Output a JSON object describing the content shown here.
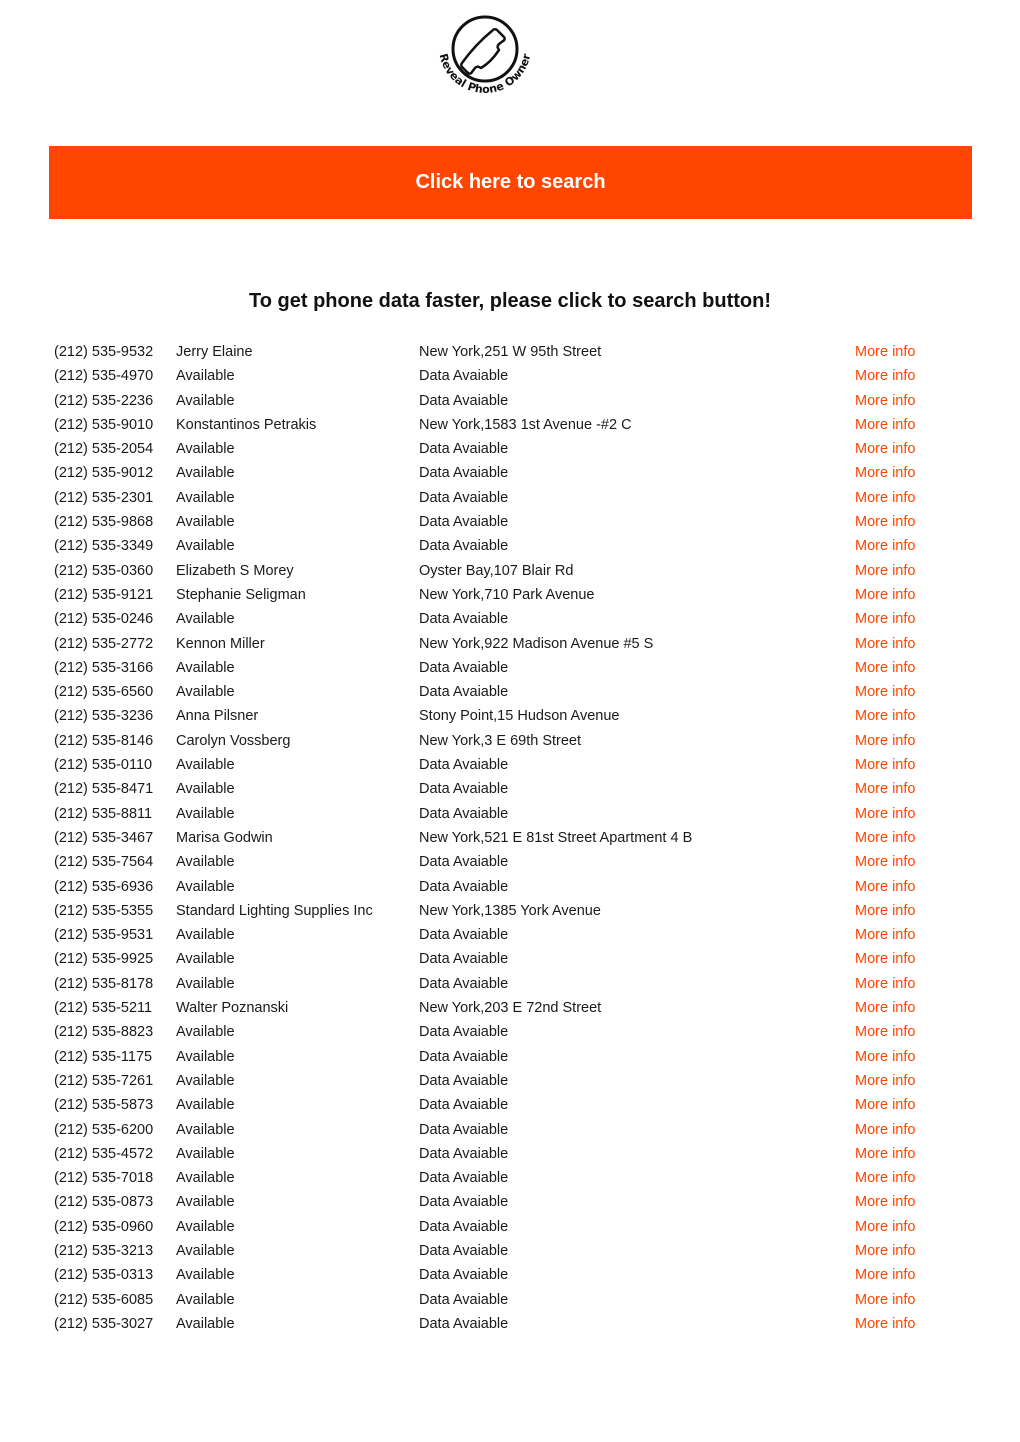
{
  "logo": {
    "text": "Reveal Phone Owner",
    "icon": "phone-handset-icon"
  },
  "banner": {
    "label": "Click here to search",
    "color": "#ff4500"
  },
  "headline": "To get phone data faster, please click to search button!",
  "more_label": "More info",
  "rows": [
    {
      "phone": "(212) 535-9532",
      "name": "Jerry Elaine",
      "address": "New York,251 W 95th Street"
    },
    {
      "phone": "(212) 535-4970",
      "name": "Available",
      "address": "Data Avaiable"
    },
    {
      "phone": "(212) 535-2236",
      "name": "Available",
      "address": "Data Avaiable"
    },
    {
      "phone": "(212) 535-9010",
      "name": "Konstantinos Petrakis",
      "address": "New York,1583 1st Avenue -#2 C"
    },
    {
      "phone": "(212) 535-2054",
      "name": "Available",
      "address": "Data Avaiable"
    },
    {
      "phone": "(212) 535-9012",
      "name": "Available",
      "address": "Data Avaiable"
    },
    {
      "phone": "(212) 535-2301",
      "name": "Available",
      "address": "Data Avaiable"
    },
    {
      "phone": "(212) 535-9868",
      "name": "Available",
      "address": "Data Avaiable"
    },
    {
      "phone": "(212) 535-3349",
      "name": "Available",
      "address": "Data Avaiable"
    },
    {
      "phone": "(212) 535-0360",
      "name": "Elizabeth S Morey",
      "address": "Oyster Bay,107 Blair Rd"
    },
    {
      "phone": "(212) 535-9121",
      "name": "Stephanie Seligman",
      "address": "New York,710 Park Avenue"
    },
    {
      "phone": "(212) 535-0246",
      "name": "Available",
      "address": "Data Avaiable"
    },
    {
      "phone": "(212) 535-2772",
      "name": "Kennon Miller",
      "address": "New York,922 Madison Avenue #5 S"
    },
    {
      "phone": "(212) 535-3166",
      "name": "Available",
      "address": "Data Avaiable"
    },
    {
      "phone": "(212) 535-6560",
      "name": "Available",
      "address": "Data Avaiable"
    },
    {
      "phone": "(212) 535-3236",
      "name": "Anna Pilsner",
      "address": "Stony Point,15 Hudson Avenue"
    },
    {
      "phone": "(212) 535-8146",
      "name": "Carolyn Vossberg",
      "address": "New York,3 E 69th Street"
    },
    {
      "phone": "(212) 535-0110",
      "name": "Available",
      "address": "Data Avaiable"
    },
    {
      "phone": "(212) 535-8471",
      "name": "Available",
      "address": "Data Avaiable"
    },
    {
      "phone": "(212) 535-8811",
      "name": "Available",
      "address": "Data Avaiable"
    },
    {
      "phone": "(212) 535-3467",
      "name": "Marisa Godwin",
      "address": "New York,521 E 81st Street Apartment 4 B"
    },
    {
      "phone": "(212) 535-7564",
      "name": "Available",
      "address": "Data Avaiable"
    },
    {
      "phone": "(212) 535-6936",
      "name": "Available",
      "address": "Data Avaiable"
    },
    {
      "phone": "(212) 535-5355",
      "name": "Standard Lighting Supplies Inc",
      "address": "New York,1385 York Avenue"
    },
    {
      "phone": "(212) 535-9531",
      "name": "Available",
      "address": "Data Avaiable"
    },
    {
      "phone": "(212) 535-9925",
      "name": "Available",
      "address": "Data Avaiable"
    },
    {
      "phone": "(212) 535-8178",
      "name": "Available",
      "address": "Data Avaiable"
    },
    {
      "phone": "(212) 535-5211",
      "name": "Walter Poznanski",
      "address": "New York,203 E 72nd Street"
    },
    {
      "phone": "(212) 535-8823",
      "name": "Available",
      "address": "Data Avaiable"
    },
    {
      "phone": "(212) 535-1175",
      "name": "Available",
      "address": "Data Avaiable"
    },
    {
      "phone": "(212) 535-7261",
      "name": "Available",
      "address": "Data Avaiable"
    },
    {
      "phone": "(212) 535-5873",
      "name": "Available",
      "address": "Data Avaiable"
    },
    {
      "phone": "(212) 535-6200",
      "name": "Available",
      "address": "Data Avaiable"
    },
    {
      "phone": "(212) 535-4572",
      "name": "Available",
      "address": "Data Avaiable"
    },
    {
      "phone": "(212) 535-7018",
      "name": "Available",
      "address": "Data Avaiable"
    },
    {
      "phone": "(212) 535-0873",
      "name": "Available",
      "address": "Data Avaiable"
    },
    {
      "phone": "(212) 535-0960",
      "name": "Available",
      "address": "Data Avaiable"
    },
    {
      "phone": "(212) 535-3213",
      "name": "Available",
      "address": "Data Avaiable"
    },
    {
      "phone": "(212) 535-0313",
      "name": "Available",
      "address": "Data Avaiable"
    },
    {
      "phone": "(212) 535-6085",
      "name": "Available",
      "address": "Data Avaiable"
    },
    {
      "phone": "(212) 535-3027",
      "name": "Available",
      "address": "Data Avaiable"
    }
  ]
}
